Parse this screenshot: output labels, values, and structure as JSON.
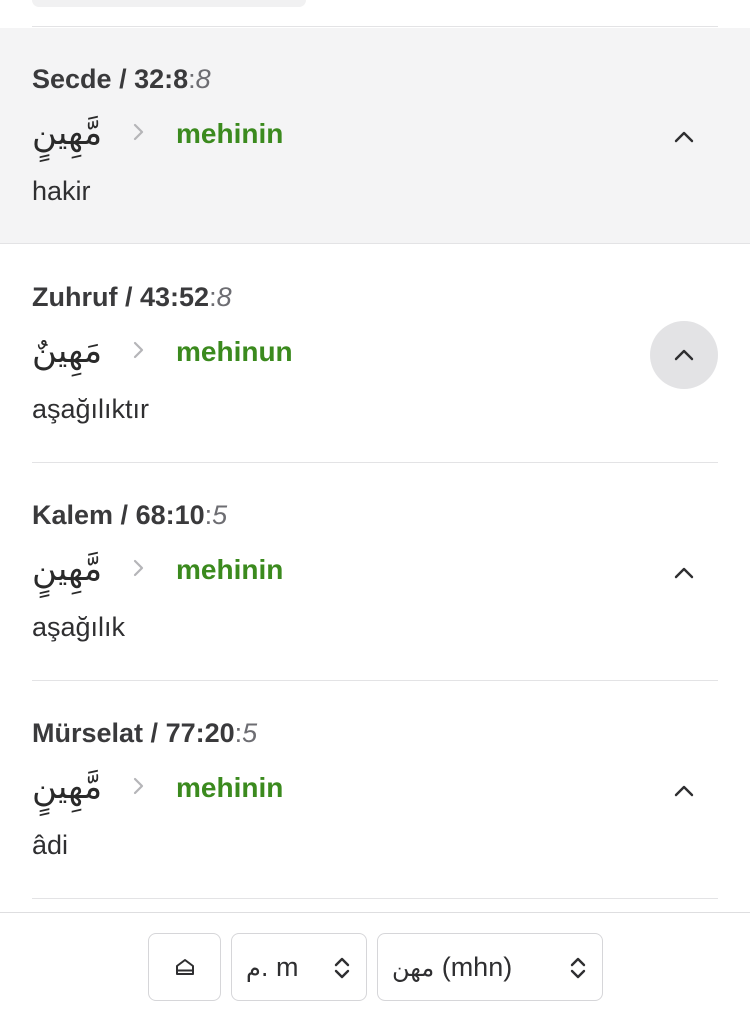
{
  "entries": [
    {
      "surah": "Secde",
      "ref": "32:8",
      "word_no": "8",
      "arabic": "مَّهِينٍ",
      "translit": "mehinin",
      "meaning": "hakir",
      "state": "active"
    },
    {
      "surah": "Zuhruf",
      "ref": "43:52",
      "word_no": "8",
      "arabic": "مَهِينٌ",
      "translit": "mehinun",
      "meaning": "aşağılıktır",
      "state": "hover"
    },
    {
      "surah": "Kalem",
      "ref": "68:10",
      "word_no": "5",
      "arabic": "مَّهِينٍ",
      "translit": "mehinin",
      "meaning": "aşağılık",
      "state": "normal"
    },
    {
      "surah": "Mürselat",
      "ref": "77:20",
      "word_no": "5",
      "arabic": "مَّهِينٍ",
      "translit": "mehinin",
      "meaning": "âdi",
      "state": "normal"
    }
  ],
  "bottom_bar": {
    "home_icon": "home-icon",
    "letter_select": {
      "arabic": "م.",
      "latin": "m"
    },
    "root_select": {
      "arabic": "مهن",
      "latin": "(mhn)"
    }
  },
  "colors": {
    "translit_green": "#3b8a1e",
    "active_row_bg": "#f4f4f5",
    "hover_circle": "#e3e3e5",
    "divider": "#e3e3e5"
  },
  "icons": {
    "separator": "chevron-right-icon",
    "toggle": "chevron-up-icon",
    "select_arrows": "chevron-up-down-icon"
  }
}
